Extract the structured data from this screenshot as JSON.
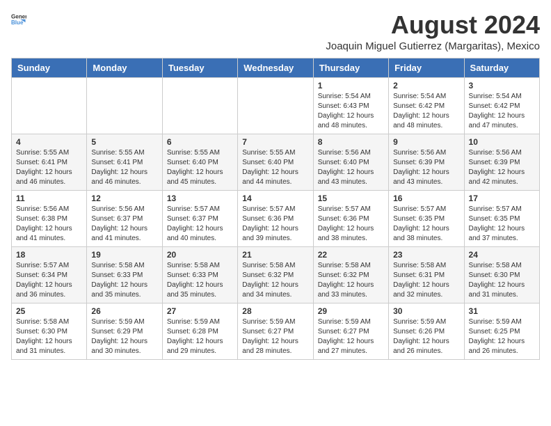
{
  "logo": {
    "general": "General",
    "blue": "Blue"
  },
  "title": "August 2024",
  "subtitle": "Joaquin Miguel Gutierrez (Margaritas), Mexico",
  "days_of_week": [
    "Sunday",
    "Monday",
    "Tuesday",
    "Wednesday",
    "Thursday",
    "Friday",
    "Saturday"
  ],
  "weeks": [
    [
      {
        "day": "",
        "info": ""
      },
      {
        "day": "",
        "info": ""
      },
      {
        "day": "",
        "info": ""
      },
      {
        "day": "",
        "info": ""
      },
      {
        "day": "1",
        "info": "Sunrise: 5:54 AM\nSunset: 6:43 PM\nDaylight: 12 hours\nand 48 minutes."
      },
      {
        "day": "2",
        "info": "Sunrise: 5:54 AM\nSunset: 6:42 PM\nDaylight: 12 hours\nand 48 minutes."
      },
      {
        "day": "3",
        "info": "Sunrise: 5:54 AM\nSunset: 6:42 PM\nDaylight: 12 hours\nand 47 minutes."
      }
    ],
    [
      {
        "day": "4",
        "info": "Sunrise: 5:55 AM\nSunset: 6:41 PM\nDaylight: 12 hours\nand 46 minutes."
      },
      {
        "day": "5",
        "info": "Sunrise: 5:55 AM\nSunset: 6:41 PM\nDaylight: 12 hours\nand 46 minutes."
      },
      {
        "day": "6",
        "info": "Sunrise: 5:55 AM\nSunset: 6:40 PM\nDaylight: 12 hours\nand 45 minutes."
      },
      {
        "day": "7",
        "info": "Sunrise: 5:55 AM\nSunset: 6:40 PM\nDaylight: 12 hours\nand 44 minutes."
      },
      {
        "day": "8",
        "info": "Sunrise: 5:56 AM\nSunset: 6:40 PM\nDaylight: 12 hours\nand 43 minutes."
      },
      {
        "day": "9",
        "info": "Sunrise: 5:56 AM\nSunset: 6:39 PM\nDaylight: 12 hours\nand 43 minutes."
      },
      {
        "day": "10",
        "info": "Sunrise: 5:56 AM\nSunset: 6:39 PM\nDaylight: 12 hours\nand 42 minutes."
      }
    ],
    [
      {
        "day": "11",
        "info": "Sunrise: 5:56 AM\nSunset: 6:38 PM\nDaylight: 12 hours\nand 41 minutes."
      },
      {
        "day": "12",
        "info": "Sunrise: 5:56 AM\nSunset: 6:37 PM\nDaylight: 12 hours\nand 41 minutes."
      },
      {
        "day": "13",
        "info": "Sunrise: 5:57 AM\nSunset: 6:37 PM\nDaylight: 12 hours\nand 40 minutes."
      },
      {
        "day": "14",
        "info": "Sunrise: 5:57 AM\nSunset: 6:36 PM\nDaylight: 12 hours\nand 39 minutes."
      },
      {
        "day": "15",
        "info": "Sunrise: 5:57 AM\nSunset: 6:36 PM\nDaylight: 12 hours\nand 38 minutes."
      },
      {
        "day": "16",
        "info": "Sunrise: 5:57 AM\nSunset: 6:35 PM\nDaylight: 12 hours\nand 38 minutes."
      },
      {
        "day": "17",
        "info": "Sunrise: 5:57 AM\nSunset: 6:35 PM\nDaylight: 12 hours\nand 37 minutes."
      }
    ],
    [
      {
        "day": "18",
        "info": "Sunrise: 5:57 AM\nSunset: 6:34 PM\nDaylight: 12 hours\nand 36 minutes."
      },
      {
        "day": "19",
        "info": "Sunrise: 5:58 AM\nSunset: 6:33 PM\nDaylight: 12 hours\nand 35 minutes."
      },
      {
        "day": "20",
        "info": "Sunrise: 5:58 AM\nSunset: 6:33 PM\nDaylight: 12 hours\nand 35 minutes."
      },
      {
        "day": "21",
        "info": "Sunrise: 5:58 AM\nSunset: 6:32 PM\nDaylight: 12 hours\nand 34 minutes."
      },
      {
        "day": "22",
        "info": "Sunrise: 5:58 AM\nSunset: 6:32 PM\nDaylight: 12 hours\nand 33 minutes."
      },
      {
        "day": "23",
        "info": "Sunrise: 5:58 AM\nSunset: 6:31 PM\nDaylight: 12 hours\nand 32 minutes."
      },
      {
        "day": "24",
        "info": "Sunrise: 5:58 AM\nSunset: 6:30 PM\nDaylight: 12 hours\nand 31 minutes."
      }
    ],
    [
      {
        "day": "25",
        "info": "Sunrise: 5:58 AM\nSunset: 6:30 PM\nDaylight: 12 hours\nand 31 minutes."
      },
      {
        "day": "26",
        "info": "Sunrise: 5:59 AM\nSunset: 6:29 PM\nDaylight: 12 hours\nand 30 minutes."
      },
      {
        "day": "27",
        "info": "Sunrise: 5:59 AM\nSunset: 6:28 PM\nDaylight: 12 hours\nand 29 minutes."
      },
      {
        "day": "28",
        "info": "Sunrise: 5:59 AM\nSunset: 6:27 PM\nDaylight: 12 hours\nand 28 minutes."
      },
      {
        "day": "29",
        "info": "Sunrise: 5:59 AM\nSunset: 6:27 PM\nDaylight: 12 hours\nand 27 minutes."
      },
      {
        "day": "30",
        "info": "Sunrise: 5:59 AM\nSunset: 6:26 PM\nDaylight: 12 hours\nand 26 minutes."
      },
      {
        "day": "31",
        "info": "Sunrise: 5:59 AM\nSunset: 6:25 PM\nDaylight: 12 hours\nand 26 minutes."
      }
    ]
  ]
}
